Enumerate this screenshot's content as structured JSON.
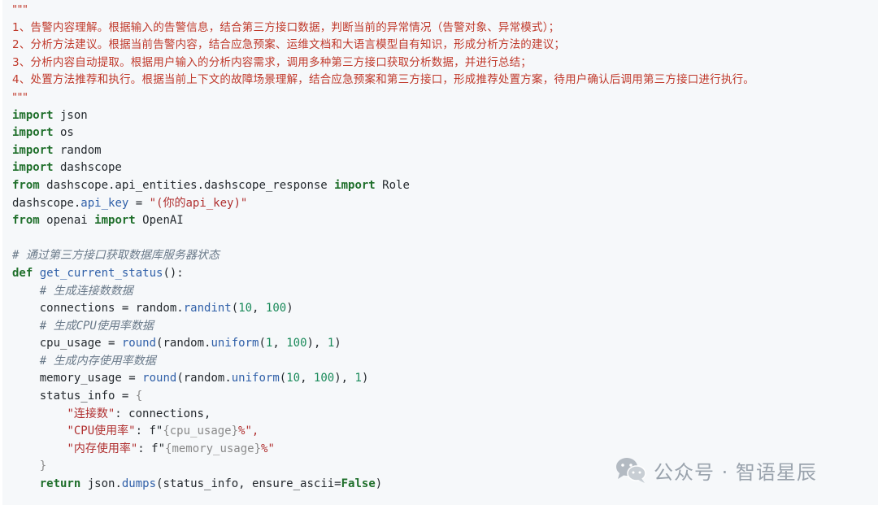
{
  "code": {
    "docstring_open": "\"\"\"",
    "doc_lines": [
      "1、告警内容理解。根据输入的告警信息，结合第三方接口数据，判断当前的异常情况（告警对象、异常模式）；",
      "2、分析方法建议。根据当前告警内容，结合应急预案、运维文档和大语言模型自有知识，形成分析方法的建议；",
      "3、分析内容自动提取。根据用户输入的分析内容需求，调用多种第三方接口获取分析数据，并进行总结；",
      "4、处置方法推荐和执行。根据当前上下文的故障场景理解，结合应急预案和第三方接口，形成推荐处置方案，待用户确认后调用第三方接口进行执行。"
    ],
    "docstring_close": "\"\"\"",
    "kw_import": "import",
    "kw_from": "from",
    "kw_def": "def",
    "kw_return": "return",
    "mod_json": " json",
    "mod_os": " os",
    "mod_random": " random",
    "mod_dashscope": " dashscope",
    "from1_module": " dashscope.api_entities.dashscope_response ",
    "from1_name": " Role",
    "apikey_obj": "dashscope.",
    "apikey_attr": "api_key",
    "apikey_eq": " = ",
    "apikey_val": "\"(你的api_key)\"",
    "from2_module": " openai ",
    "from2_name": " OpenAI",
    "comment_fn": "# 通过第三方接口获取数据库服务器状态",
    "fn_name": "get_current_status",
    "fn_tail": "():",
    "comment_conn": "# 生成连接数数据",
    "conn_lhs": "connections = random.",
    "conn_call": "randint",
    "conn_open": "(",
    "conn_a": "10",
    "conn_sep": ", ",
    "conn_b": "100",
    "conn_close": ")",
    "comment_cpu": "# 生成CPU使用率数据",
    "cpu_lhs": "cpu_usage = ",
    "round": "round",
    "cpu_mid": "(random.",
    "uniform": "uniform",
    "cpu_a": "1",
    "cpu_b": "100",
    "cpu_end": "), ",
    "cpu_digits": "1",
    "comment_mem": "# 生成内存使用率数据",
    "mem_lhs": "memory_usage = ",
    "mem_a": "10",
    "mem_b": "100",
    "mem_digits": "1",
    "status_lhs": "status_info = ",
    "brace_open": "{",
    "key_conn": "\"连接数\"",
    "val_conn": ": connections,",
    "key_cpu": "\"CPU使用率\"",
    "val_cpu_pre": ": f\"",
    "val_cpu_expr": "{cpu_usage}",
    "val_cpu_post": "%\",",
    "key_mem": "\"内存使用率\"",
    "val_mem_pre": ": f\"",
    "val_mem_expr": "{memory_usage}",
    "val_mem_post": "%\"",
    "brace_close": "}",
    "ret_mid": " json.",
    "ret_call": "dumps",
    "ret_args": "(status_info, ensure_ascii=",
    "ret_false": "False",
    "ret_end": ")"
  },
  "watermark": {
    "text": "公众号 · 智语星辰",
    "icon": "wechat-icon"
  },
  "colors": {
    "docstring": "#c0392b",
    "keyword": "#1f6f2b",
    "background": "#f6f8fa"
  }
}
